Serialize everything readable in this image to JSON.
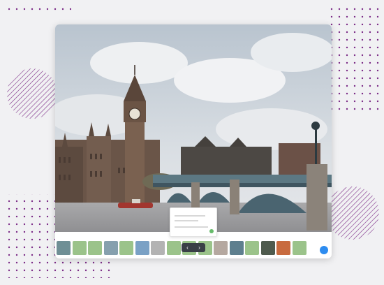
{
  "app": {
    "title": "",
    "controls": {
      "prev_icon": "chevron-left-icon",
      "next_icon": "chevron-right-icon"
    },
    "dock": {
      "caption_left": "",
      "caption_right": ""
    }
  },
  "colors": {
    "dots": "#7b2a86",
    "accent_blue": "#2d8cf0",
    "accent_green": "#66bb6a",
    "photo_sky": "#c9d2db",
    "photo_building": "#6a5548",
    "bridge": "#4f6a75",
    "river": "#9e9ea1"
  },
  "thumbnails": [
    {
      "name": "thumb-1",
      "color": "#6f8f95"
    },
    {
      "name": "thumb-2",
      "color": "#9bc38a"
    },
    {
      "name": "thumb-3",
      "color": "#9bc38a"
    },
    {
      "name": "thumb-4",
      "color": "#86a0ae"
    },
    {
      "name": "thumb-5",
      "color": "#9bc38a"
    },
    {
      "name": "thumb-6",
      "color": "#7aa1c5"
    },
    {
      "name": "thumb-7",
      "color": "#b3b3b3"
    },
    {
      "name": "thumb-8",
      "color": "#9bc38a"
    },
    {
      "name": "thumb-9",
      "color": "#9bc38a"
    },
    {
      "name": "thumb-10",
      "color": "#9bc38a"
    },
    {
      "name": "thumb-11",
      "color": "#b5a8a0"
    },
    {
      "name": "thumb-12",
      "color": "#5e7f8e"
    },
    {
      "name": "thumb-13",
      "color": "#9bc38a"
    },
    {
      "name": "thumb-14",
      "color": "#4f5b4e"
    },
    {
      "name": "thumb-15",
      "color": "#c86b3f"
    },
    {
      "name": "thumb-16",
      "color": "#9bc38a"
    }
  ]
}
